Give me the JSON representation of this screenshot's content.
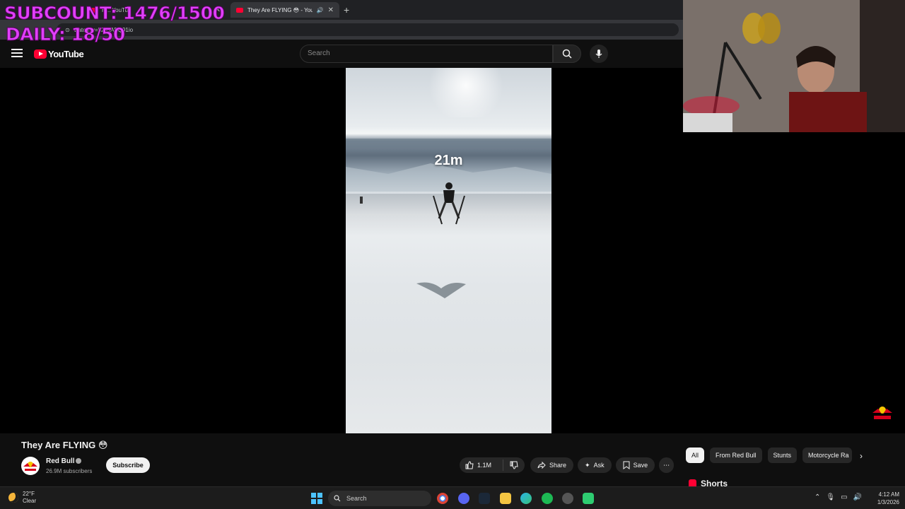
{
  "overlay": {
    "subcount": "SUBCOUNT: 1476/1500",
    "daily": "DAILY: 18/50"
  },
  "browser": {
    "tabs": [
      {
        "label": "H...  YouTu",
        "active": false
      },
      {
        "label": "They Are FLYING 😳 - YouT",
        "active": true
      }
    ],
    "url": "watch?v=52fOAEQ91io"
  },
  "youtube": {
    "brand": "YouTube",
    "search_placeholder": "Search"
  },
  "video": {
    "overlay_text": "21m"
  },
  "meta": {
    "title": "They Are FLYING 😳",
    "channel": "Red Bull",
    "subscribers": "26.9M subscribers",
    "subscribe_label": "Subscribe",
    "likes": "1.1M",
    "share_label": "Share",
    "ask_label": "Ask",
    "save_label": "Save"
  },
  "chips": [
    "All",
    "From Red Bull",
    "Stunts",
    "Motorcycle Ra"
  ],
  "shorts_label": "Shorts",
  "taskbar": {
    "temp": "22°F",
    "condition": "Clear",
    "search_label": "Search",
    "time": "4:12 AM",
    "date": "1/3/2026"
  },
  "colors": {
    "overlay_text": "#e040fb",
    "yt_red": "#ff0033",
    "background": "#0f0f0f"
  }
}
